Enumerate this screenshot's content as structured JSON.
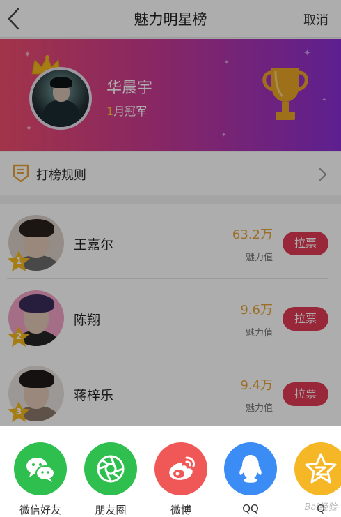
{
  "header": {
    "title": "魅力明星榜",
    "cancel_label": "取消",
    "back_icon": "chevron-left-icon"
  },
  "banner": {
    "champion_name": "华晨宇",
    "champion_month_num": "1",
    "champion_month_text": "月冠军",
    "gradient_colors": [
      "#ef4d6d",
      "#c93a92",
      "#8a2fd4"
    ],
    "icons": [
      "crown-icon",
      "trophy-icon"
    ]
  },
  "rules": {
    "label": "打榜规则",
    "icon": "rules-icon"
  },
  "ranking": [
    {
      "rank": "1",
      "name": "王嘉尔",
      "score": "63.2万",
      "score_label": "魅力值",
      "vote_label": "拉票"
    },
    {
      "rank": "2",
      "name": "陈翔",
      "score": "9.6万",
      "score_label": "魅力值",
      "vote_label": "拉票"
    },
    {
      "rank": "3",
      "name": "蒋梓乐",
      "score": "9.4万",
      "score_label": "魅力值",
      "vote_label": "拉票"
    }
  ],
  "share_sheet": {
    "items": [
      {
        "label": "微信好友",
        "icon": "wechat-icon",
        "color": "#2fbf4f"
      },
      {
        "label": "朋友圈",
        "icon": "moments-icon",
        "color": "#2fbf4f"
      },
      {
        "label": "微博",
        "icon": "weibo-icon",
        "color": "#f05858"
      },
      {
        "label": "QQ",
        "icon": "qq-icon",
        "color": "#3b8cf5"
      },
      {
        "label": "Q",
        "icon": "qzone-icon",
        "color": "#f6b726"
      }
    ]
  },
  "accent_colors": {
    "score": "#e8a33a",
    "vote_button": "#e23a56",
    "month_number": "#ffc23a"
  },
  "watermark": "Bai经验"
}
